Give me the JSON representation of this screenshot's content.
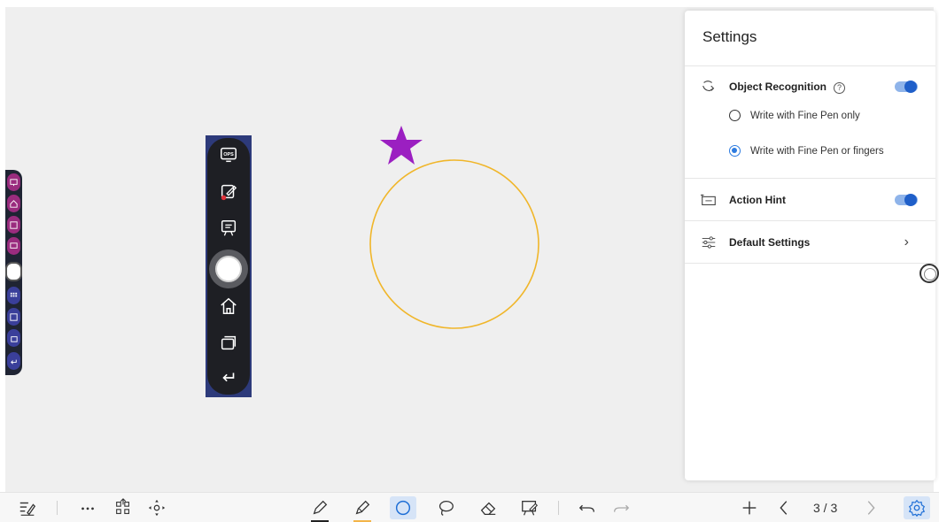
{
  "settings": {
    "title": "Settings",
    "object_recognition": {
      "label": "Object Recognition",
      "help": "?",
      "enabled": true
    },
    "radio_fine_pen_only": "Write with Fine Pen only",
    "radio_fine_pen_or_fingers": "Write with Fine Pen or fingers",
    "selected_mode": "Write with Fine Pen or fingers",
    "action_hint": {
      "label": "Action Hint",
      "enabled": true
    },
    "default_settings": {
      "label": "Default Settings",
      "chevron": "›"
    }
  },
  "floating_toolbar": {
    "ops_label": "OPS",
    "items": [
      "ops-icon",
      "annotate-icon",
      "whiteboard-icon",
      "home-button-circle",
      "home-icon",
      "windows-icon",
      "back-icon"
    ]
  },
  "drawing": {
    "star_color": "#9b1fc1",
    "circle_color": "#f0b62a"
  },
  "bottom_toolbar": {
    "page_indicator": "3 / 3",
    "pen_color": "#222222",
    "highlighter_color": "#f3b54a",
    "active_tool": "circle-tool",
    "accent": "#1f6fd6"
  }
}
